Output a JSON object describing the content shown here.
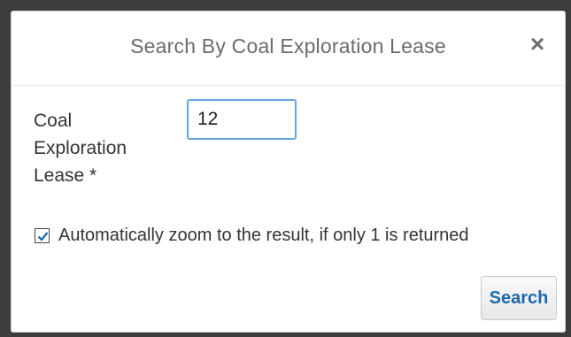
{
  "dialog": {
    "title": "Search By Coal Exploration Lease",
    "close_glyph": "×",
    "field": {
      "label": "Coal Exploration Lease *",
      "value": "12"
    },
    "checkbox": {
      "checked": true,
      "label": "Automatically zoom to the result, if only 1 is returned"
    },
    "search_button_label": "Search"
  },
  "colors": {
    "accent": "#1b68ad",
    "input_focus_border": "#66a6e0"
  }
}
